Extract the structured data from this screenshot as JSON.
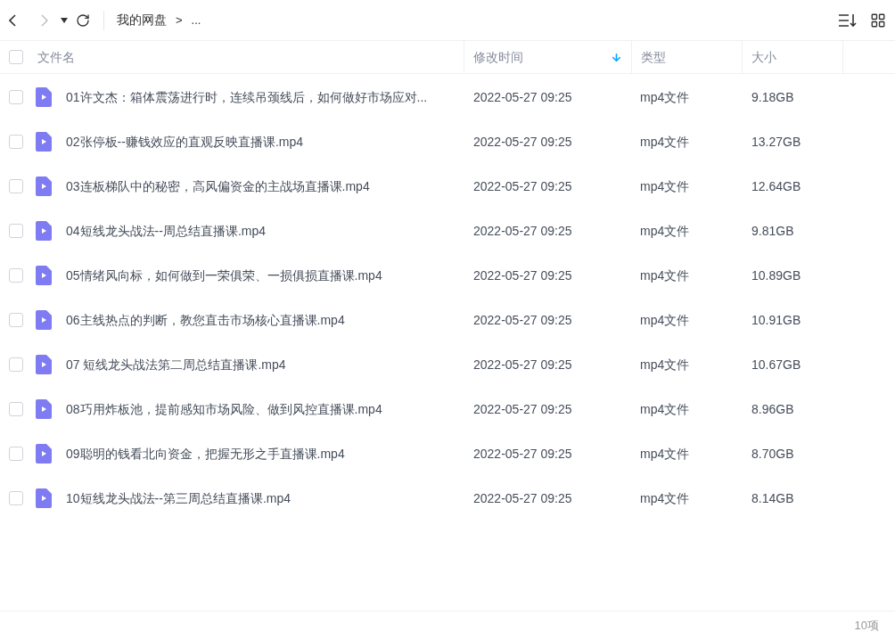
{
  "toolbar": {
    "breadcrumb": "我的网盘",
    "separator": ">",
    "ellipsis": "..."
  },
  "table": {
    "select_all": {
      "checked": false
    },
    "columns": [
      {
        "label": "文件名",
        "sorted": false
      },
      {
        "label": "修改时间",
        "sorted": true
      },
      {
        "label": "类型",
        "sorted": false
      },
      {
        "label": "大小",
        "sorted": false
      }
    ],
    "rows": [
      {
        "checked": false,
        "name": "01许文杰：箱体震荡进行时，连续吊颈线后，如何做好市场应对...",
        "modified": "2022-05-27 09:25",
        "type": "mp4文件",
        "size": "9.18GB"
      },
      {
        "checked": false,
        "name": "02张停板--赚钱效应的直观反映直播课.mp4",
        "modified": "2022-05-27 09:25",
        "type": "mp4文件",
        "size": "13.27GB"
      },
      {
        "checked": false,
        "name": "03连板梯队中的秘密，高风偏资金的主战场直播课.mp4",
        "modified": "2022-05-27 09:25",
        "type": "mp4文件",
        "size": "12.64GB"
      },
      {
        "checked": false,
        "name": "04短线龙头战法--周总结直播课.mp4",
        "modified": "2022-05-27 09:25",
        "type": "mp4文件",
        "size": "9.81GB"
      },
      {
        "checked": false,
        "name": "05情绪风向标，如何做到一荣俱荣、一损俱损直播课.mp4",
        "modified": "2022-05-27 09:25",
        "type": "mp4文件",
        "size": "10.89GB"
      },
      {
        "checked": false,
        "name": "06主线热点的判断，教您直击市场核心直播课.mp4",
        "modified": "2022-05-27 09:25",
        "type": "mp4文件",
        "size": "10.91GB"
      },
      {
        "checked": false,
        "name": "07 短线龙头战法第二周总结直播课.mp4",
        "modified": "2022-05-27 09:25",
        "type": "mp4文件",
        "size": "10.67GB"
      },
      {
        "checked": false,
        "name": "08巧用炸板池，提前感知市场风险、做到风控直播课.mp4",
        "modified": "2022-05-27 09:25",
        "type": "mp4文件",
        "size": "8.96GB"
      },
      {
        "checked": false,
        "name": "09聪明的钱看北向资金，把握无形之手直播课.mp4",
        "modified": "2022-05-27 09:25",
        "type": "mp4文件",
        "size": "8.70GB"
      },
      {
        "checked": false,
        "name": "10短线龙头战法--第三周总结直播课.mp4",
        "modified": "2022-05-27 09:25",
        "type": "mp4文件",
        "size": "8.14GB"
      }
    ]
  },
  "status_bar": {
    "count": "10项"
  }
}
